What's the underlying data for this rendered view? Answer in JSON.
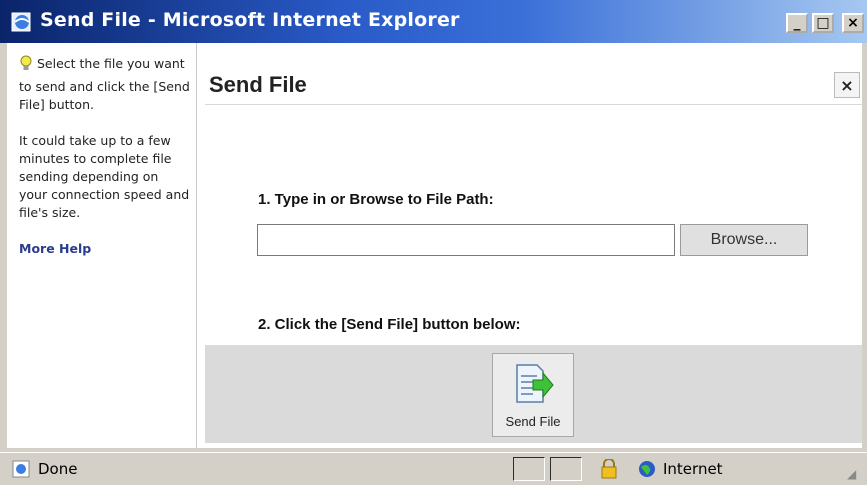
{
  "window": {
    "title": "Send File - Microsoft Internet Explorer",
    "minimize_label": "_",
    "maximize_label": "□",
    "close_label": "×"
  },
  "sidebar": {
    "instruction": "Select the file you want to send and click the [Send File] button.",
    "note": "It could take up to a few minutes to complete file sending depending on your connection speed and file's size.",
    "help_link": "More Help"
  },
  "dialog": {
    "title": "Send File",
    "close_label": "×",
    "step1_label": "1. Type in or Browse to File Path:",
    "file_path_value": "",
    "browse_label": "Browse...",
    "step2_label": "2. Click the [Send File] button below:",
    "send_label": "Send File"
  },
  "statusbar": {
    "status": "Done",
    "zone": "Internet"
  },
  "colors": {
    "title_bar": "#0a246a",
    "link": "#2b3c8e",
    "action_area": "#dadada"
  }
}
